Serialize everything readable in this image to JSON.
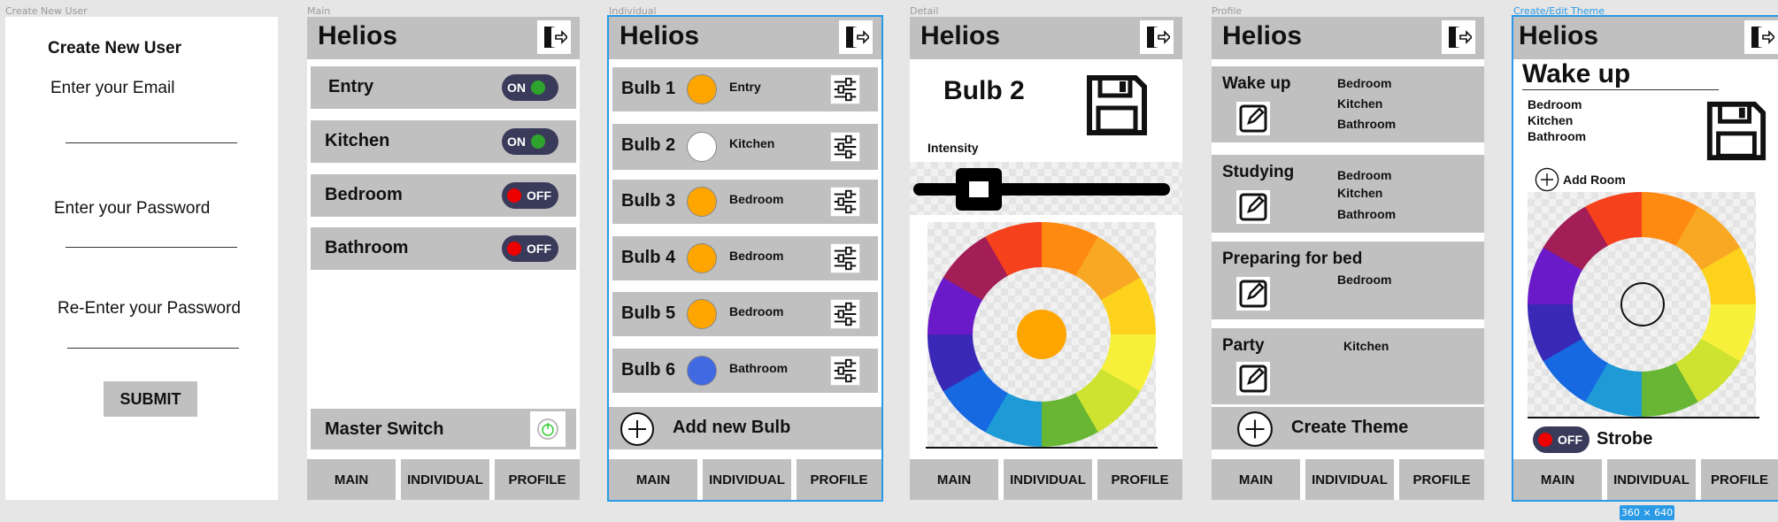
{
  "artboards": {
    "create_user": "Create New User",
    "main": "Main",
    "individual": "Individual",
    "detail": "Detail",
    "profile": "Profile",
    "theme": "Create/Edit Theme"
  },
  "app_title": "Helios",
  "nav": {
    "main": "MAIN",
    "individual": "INDIVIDUAL",
    "profile": "PROFILE"
  },
  "create_user": {
    "heading": "Create New User",
    "email_label": "Enter your Email",
    "password_label": "Enter your Password",
    "reenter_label": "Re-Enter your Password",
    "submit": "SUBMIT"
  },
  "main": {
    "rooms": [
      {
        "name": "Entry",
        "state": "ON"
      },
      {
        "name": "Kitchen",
        "state": "ON"
      },
      {
        "name": "Bedroom",
        "state": "OFF"
      },
      {
        "name": "Bathroom",
        "state": "OFF"
      }
    ],
    "master": "Master Switch"
  },
  "individual": {
    "bulbs": [
      {
        "name": "Bulb 1",
        "room": "Entry",
        "color": "#ffa500"
      },
      {
        "name": "Bulb 2",
        "room": "Kitchen",
        "color": "#ffffff"
      },
      {
        "name": "Bulb 3",
        "room": "Bedroom",
        "color": "#ffa500"
      },
      {
        "name": "Bulb 4",
        "room": "Bedroom",
        "color": "#ffa500"
      },
      {
        "name": "Bulb 5",
        "room": "Bedroom",
        "color": "#ffa500"
      },
      {
        "name": "Bulb 6",
        "room": "Bathroom",
        "color": "#4169e1"
      }
    ],
    "add": "Add new Bulb"
  },
  "detail": {
    "title": "Bulb 2",
    "intensity": "Intensity",
    "center_color": "#ffa500"
  },
  "profile": {
    "themes": [
      {
        "name": "Wake up",
        "rooms": [
          "Bedroom",
          "Kitchen",
          "Bathroom"
        ]
      },
      {
        "name": "Studying",
        "rooms": [
          "Bedroom",
          "Kitchen",
          "Bathroom"
        ]
      },
      {
        "name": "Preparing for bed",
        "rooms": [
          "Bedroom"
        ]
      },
      {
        "name": "Party",
        "rooms": [
          "Kitchen"
        ]
      }
    ],
    "create": "Create Theme"
  },
  "theme": {
    "name": "Wake up",
    "rooms": [
      "Bedroom",
      "Kitchen",
      "Bathroom"
    ],
    "add_room": "Add Room",
    "strobe": "Strobe",
    "strobe_state": "OFF"
  },
  "size_badge": "360 × 640"
}
